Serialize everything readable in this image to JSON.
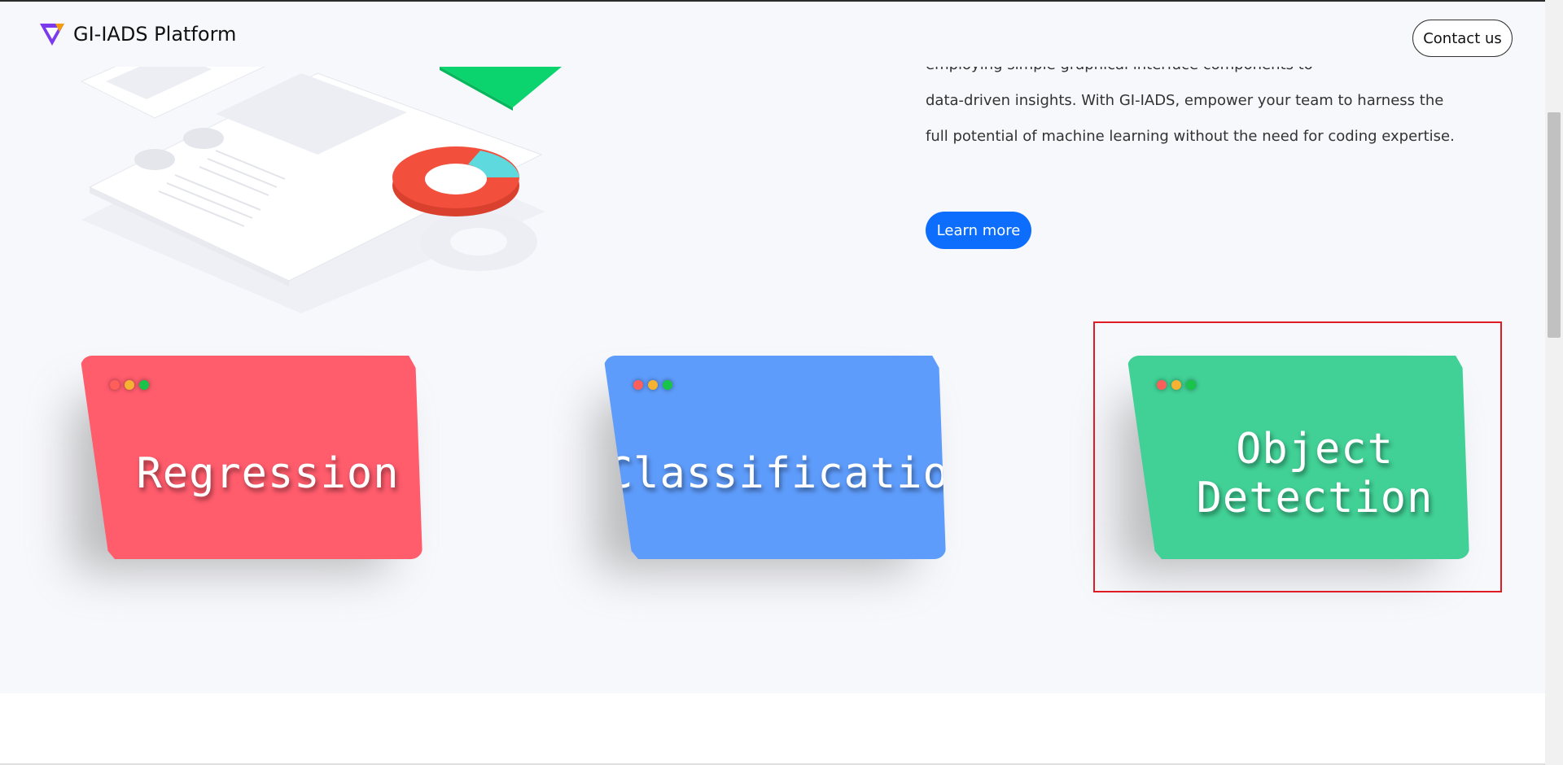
{
  "header": {
    "brand": "GI-IADS Platform",
    "contact_label": "Contact us"
  },
  "hero": {
    "lines": [
      "employing simple graphical interface components to",
      "data-driven insights. With GI-IADS, empower your team to harness the",
      "full potential of machine learning without the need for coding expertise."
    ],
    "learn_more_label": "Learn more"
  },
  "cards": [
    {
      "title": "Regression",
      "color": "#ff5c6c"
    },
    {
      "title": "Classification",
      "color": "#5e9cfb"
    },
    {
      "title": "Object Detection",
      "color": "#41d095"
    }
  ],
  "colors": {
    "accent": "#0d6efd",
    "highlight": "#e01b24"
  },
  "icons": {
    "logo": "gi-iads-logo-icon",
    "window_dots": [
      "red-dot-icon",
      "yellow-dot-icon",
      "green-dot-icon"
    ]
  }
}
